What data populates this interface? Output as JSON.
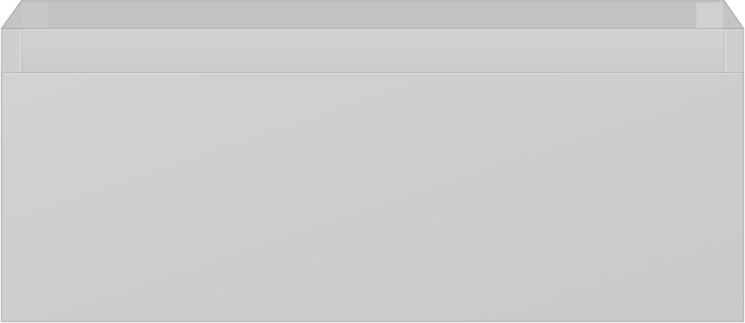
{
  "image": {
    "subject": "drawer-box",
    "colors": {
      "background": "#ffffff",
      "front_panel_light": "#d2d2d2",
      "front_panel_dark": "#c9c9c9",
      "top_rim": "#c4c4c4",
      "inner_back": "#c2c2c2",
      "inner_side_left": "#c7c7c7",
      "inner_side_right": "#d0d0d0",
      "side_post_left": "#cfcfcf",
      "side_post_right": "#cfcfcf",
      "inner_wall": "#cfcfcf",
      "outline": "#a5a5a5",
      "highlight": "#e6e6e6"
    }
  }
}
